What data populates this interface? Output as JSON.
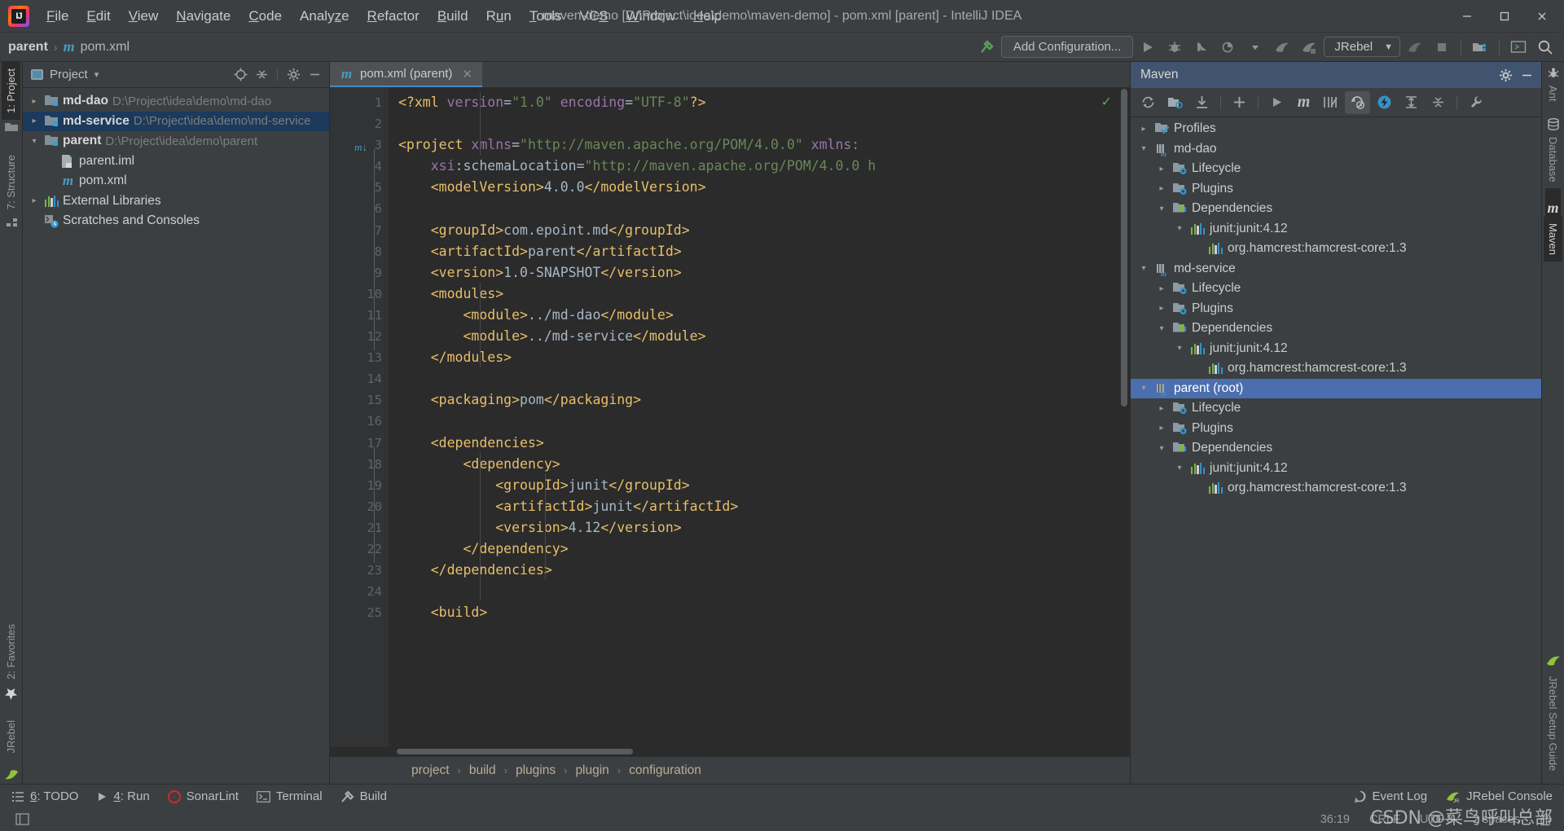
{
  "window": {
    "title": "maven-demo [D:\\Project\\idea\\demo\\maven-demo] - pom.xml [parent] - IntelliJ IDEA",
    "minimize": "–",
    "maximize": "☐",
    "close": "✕",
    "logo_text": "IJ"
  },
  "menubar": [
    {
      "label": "File",
      "mnemonic": "F"
    },
    {
      "label": "Edit",
      "mnemonic": "E"
    },
    {
      "label": "View",
      "mnemonic": "V"
    },
    {
      "label": "Navigate",
      "mnemonic": "N"
    },
    {
      "label": "Code",
      "mnemonic": "C"
    },
    {
      "label": "Analyze",
      "mnemonic": "z"
    },
    {
      "label": "Refactor",
      "mnemonic": "R"
    },
    {
      "label": "Build",
      "mnemonic": "B"
    },
    {
      "label": "Run",
      "mnemonic": "u"
    },
    {
      "label": "Tools",
      "mnemonic": "T"
    },
    {
      "label": "VCS",
      "mnemonic": "S"
    },
    {
      "label": "Window",
      "mnemonic": "W"
    },
    {
      "label": "Help",
      "mnemonic": "H"
    }
  ],
  "toolbar": {
    "breadcrumb_project": "parent",
    "breadcrumb_sep": "›",
    "breadcrumb_file_icon": "m",
    "breadcrumb_file": "pom.xml",
    "add_configuration": "Add Configuration...",
    "jrebel_label": "JRebel",
    "jrebel_caret": "▼",
    "icons": {
      "build": "build-hammer-icon",
      "run": "run-icon",
      "debug": "debug-icon",
      "run_coverage": "run-with-coverage-icon",
      "profiler": "profiler-icon",
      "jrebel_run": "jrebel-run-icon",
      "jrebel_debug": "jrebel-debug-icon",
      "jrebel_stop": "jrebel-stop-icon",
      "stop": "stop-icon",
      "project_structure": "project-structure-icon",
      "terminal": "terminal-icon",
      "search": "search-everywhere-icon"
    }
  },
  "left_strip": [
    {
      "label": "1: Project",
      "mnemonic": "1",
      "active": true,
      "icon": "project-icon"
    },
    {
      "label": "7: Structure",
      "mnemonic": "7",
      "active": false,
      "icon": "structure-icon"
    },
    {
      "label": "2: Favorites",
      "mnemonic": "2",
      "active": false,
      "icon": "star-icon"
    },
    {
      "label": "JRebel",
      "mnemonic": "",
      "active": false,
      "icon": "jrebel-icon"
    }
  ],
  "right_strip": [
    {
      "label": "Ant",
      "active": false,
      "icon": "ant-icon"
    },
    {
      "label": "Database",
      "active": false,
      "icon": "database-icon"
    },
    {
      "label": "Maven",
      "active": true,
      "icon": "maven-icon"
    },
    {
      "label": "JRebel Setup Guide",
      "active": false,
      "icon": "jrebel-icon"
    }
  ],
  "project_panel": {
    "title": "Project",
    "caret": "▾",
    "actions": [
      "locate-icon",
      "collapse-all-icon",
      "settings-gear-icon",
      "hide-icon"
    ],
    "tree": [
      {
        "indent": 0,
        "arrow": "▸",
        "icon": "module-folder-icon",
        "label": "md-dao",
        "bold": true,
        "path": "D:\\Project\\idea\\demo\\md-dao",
        "selected": false
      },
      {
        "indent": 0,
        "arrow": "▸",
        "icon": "module-folder-icon",
        "label": "md-service",
        "bold": true,
        "path": "D:\\Project\\idea\\demo\\md-service",
        "selected": true
      },
      {
        "indent": 0,
        "arrow": "▾",
        "icon": "module-folder-icon",
        "label": "parent",
        "bold": true,
        "path": "D:\\Project\\idea\\demo\\parent",
        "selected": false
      },
      {
        "indent": 1,
        "arrow": "",
        "icon": "iml-file-icon",
        "label": "parent.iml",
        "bold": false,
        "path": "",
        "selected": false
      },
      {
        "indent": 1,
        "arrow": "",
        "icon": "maven-file-icon",
        "label": "pom.xml",
        "bold": false,
        "path": "",
        "selected": false
      },
      {
        "indent": 0,
        "arrow": "▸",
        "icon": "library-icon",
        "label": "External Libraries",
        "bold": false,
        "path": "",
        "selected": false
      },
      {
        "indent": 0,
        "arrow": "",
        "icon": "scratches-icon",
        "label": "Scratches and Consoles",
        "bold": false,
        "path": "",
        "selected": false
      }
    ]
  },
  "editor": {
    "tab": {
      "icon": "maven-file-icon",
      "label": "pom.xml (parent)",
      "close": "✕"
    },
    "inspection_status": "✓",
    "gutter_marker_line": 3,
    "gutter_marker": "m",
    "lines": [
      {
        "n": 1,
        "fold": "",
        "segments": [
          {
            "t": "<?xml ",
            "c": "tag"
          },
          {
            "t": "version",
            "c": "attr"
          },
          {
            "t": "=",
            "c": "txt"
          },
          {
            "t": "\"1.0\"",
            "c": "str"
          },
          {
            "t": " ",
            "c": "txt"
          },
          {
            "t": "encoding",
            "c": "attr"
          },
          {
            "t": "=",
            "c": "txt"
          },
          {
            "t": "\"UTF-8\"",
            "c": "str"
          },
          {
            "t": "?>",
            "c": "tag"
          }
        ]
      },
      {
        "n": 2,
        "fold": "",
        "segments": []
      },
      {
        "n": 3,
        "fold": "-",
        "segments": [
          {
            "t": "<project ",
            "c": "tag"
          },
          {
            "t": "xmlns",
            "c": "attr"
          },
          {
            "t": "=",
            "c": "txt"
          },
          {
            "t": "\"http://maven.apache.org/POM/4.0.0\"",
            "c": "str"
          },
          {
            "t": " ",
            "c": "txt"
          },
          {
            "t": "xmlns:",
            "c": "attr"
          }
        ]
      },
      {
        "n": 4,
        "fold": "",
        "segments": [
          {
            "t": "    ",
            "c": "txt"
          },
          {
            "t": "xsi",
            "c": "attr"
          },
          {
            "t": ":schemaLocation",
            "c": "txt"
          },
          {
            "t": "=",
            "c": "txt"
          },
          {
            "t": "\"http://maven.apache.org/POM/4.0.0 h",
            "c": "str"
          }
        ]
      },
      {
        "n": 5,
        "fold": "",
        "segments": [
          {
            "t": "    ",
            "c": "txt"
          },
          {
            "t": "<modelVersion>",
            "c": "tag"
          },
          {
            "t": "4.0.0",
            "c": "txt"
          },
          {
            "t": "</modelVersion>",
            "c": "tag"
          }
        ]
      },
      {
        "n": 6,
        "fold": "",
        "segments": []
      },
      {
        "n": 7,
        "fold": "",
        "segments": [
          {
            "t": "    ",
            "c": "txt"
          },
          {
            "t": "<groupId>",
            "c": "tag"
          },
          {
            "t": "com.epoint.md",
            "c": "txt"
          },
          {
            "t": "</groupId>",
            "c": "tag"
          }
        ]
      },
      {
        "n": 8,
        "fold": "",
        "segments": [
          {
            "t": "    ",
            "c": "txt"
          },
          {
            "t": "<artifactId>",
            "c": "tag"
          },
          {
            "t": "parent",
            "c": "txt"
          },
          {
            "t": "</artifactId>",
            "c": "tag"
          }
        ]
      },
      {
        "n": 9,
        "fold": "",
        "segments": [
          {
            "t": "    ",
            "c": "txt"
          },
          {
            "t": "<version>",
            "c": "tag"
          },
          {
            "t": "1.0-SNAPSHOT",
            "c": "txt"
          },
          {
            "t": "</version>",
            "c": "tag"
          }
        ]
      },
      {
        "n": 10,
        "fold": "-",
        "segments": [
          {
            "t": "    ",
            "c": "txt"
          },
          {
            "t": "<modules>",
            "c": "tag"
          }
        ]
      },
      {
        "n": 11,
        "fold": "",
        "segments": [
          {
            "t": "        ",
            "c": "txt"
          },
          {
            "t": "<module>",
            "c": "tag"
          },
          {
            "t": "../md-dao",
            "c": "txt"
          },
          {
            "t": "</module>",
            "c": "tag"
          }
        ]
      },
      {
        "n": 12,
        "fold": "",
        "segments": [
          {
            "t": "        ",
            "c": "txt"
          },
          {
            "t": "<module>",
            "c": "tag"
          },
          {
            "t": "../md-service",
            "c": "txt"
          },
          {
            "t": "</module>",
            "c": "tag"
          }
        ]
      },
      {
        "n": 13,
        "fold": "u",
        "segments": [
          {
            "t": "    ",
            "c": "txt"
          },
          {
            "t": "</modules>",
            "c": "tag"
          }
        ]
      },
      {
        "n": 14,
        "fold": "",
        "segments": []
      },
      {
        "n": 15,
        "fold": "",
        "segments": [
          {
            "t": "    ",
            "c": "txt"
          },
          {
            "t": "<packaging>",
            "c": "tag"
          },
          {
            "t": "pom",
            "c": "txt"
          },
          {
            "t": "</packaging>",
            "c": "tag"
          }
        ]
      },
      {
        "n": 16,
        "fold": "",
        "segments": []
      },
      {
        "n": 17,
        "fold": "-",
        "segments": [
          {
            "t": "    ",
            "c": "txt"
          },
          {
            "t": "<dependencies>",
            "c": "tag"
          }
        ]
      },
      {
        "n": 18,
        "fold": "-",
        "segments": [
          {
            "t": "        ",
            "c": "txt"
          },
          {
            "t": "<dependency>",
            "c": "tag"
          }
        ]
      },
      {
        "n": 19,
        "fold": "",
        "segments": [
          {
            "t": "            ",
            "c": "txt"
          },
          {
            "t": "<groupId>",
            "c": "tag"
          },
          {
            "t": "junit",
            "c": "txt"
          },
          {
            "t": "</groupId>",
            "c": "tag"
          }
        ]
      },
      {
        "n": 20,
        "fold": "",
        "segments": [
          {
            "t": "            ",
            "c": "txt"
          },
          {
            "t": "<artifactId>",
            "c": "tag"
          },
          {
            "t": "junit",
            "c": "txt"
          },
          {
            "t": "</artifactId>",
            "c": "tag"
          }
        ]
      },
      {
        "n": 21,
        "fold": "",
        "segments": [
          {
            "t": "            ",
            "c": "txt"
          },
          {
            "t": "<version>",
            "c": "tag"
          },
          {
            "t": "4.12",
            "c": "txt"
          },
          {
            "t": "</version>",
            "c": "tag"
          }
        ]
      },
      {
        "n": 22,
        "fold": "u",
        "segments": [
          {
            "t": "        ",
            "c": "txt"
          },
          {
            "t": "</dependency>",
            "c": "tag"
          }
        ]
      },
      {
        "n": 23,
        "fold": "u",
        "segments": [
          {
            "t": "    ",
            "c": "txt"
          },
          {
            "t": "</dependencies>",
            "c": "tag"
          }
        ]
      },
      {
        "n": 24,
        "fold": "",
        "segments": []
      },
      {
        "n": 25,
        "fold": "-",
        "segments": [
          {
            "t": "    ",
            "c": "txt"
          },
          {
            "t": "<build>",
            "c": "tag"
          }
        ]
      }
    ],
    "breadcrumbs": [
      "project",
      "build",
      "plugins",
      "plugin",
      "configuration"
    ],
    "breadcrumb_sep": "›"
  },
  "maven_panel": {
    "title": "Maven",
    "actions": [
      "settings-gear-icon",
      "hide-icon"
    ],
    "toolbar_icons": [
      "reimport-icon",
      "generate-sources-icon",
      "download-sources-icon",
      "add-maven-project-icon",
      "run-icon",
      "maven-goal-icon",
      "toggle-skip-tests-icon",
      "toggle-offline-icon",
      "execute-goal-icon",
      "expand-all-icon",
      "collapse-all-icon",
      "maven-settings-icon"
    ],
    "tree": [
      {
        "indent": 0,
        "arrow": "▸",
        "icon": "profiles-icon",
        "label": "Profiles",
        "selected": false
      },
      {
        "indent": 0,
        "arrow": "▾",
        "icon": "maven-module-icon",
        "label": "md-dao",
        "selected": false
      },
      {
        "indent": 1,
        "arrow": "▸",
        "icon": "lifecycle-folder-icon",
        "label": "Lifecycle",
        "selected": false
      },
      {
        "indent": 1,
        "arrow": "▸",
        "icon": "plugins-folder-icon",
        "label": "Plugins",
        "selected": false
      },
      {
        "indent": 1,
        "arrow": "▾",
        "icon": "dependencies-icon",
        "label": "Dependencies",
        "selected": false
      },
      {
        "indent": 2,
        "arrow": "▾",
        "icon": "library-icon",
        "label": "junit:junit:4.12",
        "selected": false
      },
      {
        "indent": 3,
        "arrow": "",
        "icon": "library-icon",
        "label": "org.hamcrest:hamcrest-core:1.3",
        "selected": false
      },
      {
        "indent": 0,
        "arrow": "▾",
        "icon": "maven-module-icon",
        "label": "md-service",
        "selected": false
      },
      {
        "indent": 1,
        "arrow": "▸",
        "icon": "lifecycle-folder-icon",
        "label": "Lifecycle",
        "selected": false
      },
      {
        "indent": 1,
        "arrow": "▸",
        "icon": "plugins-folder-icon",
        "label": "Plugins",
        "selected": false
      },
      {
        "indent": 1,
        "arrow": "▾",
        "icon": "dependencies-icon",
        "label": "Dependencies",
        "selected": false
      },
      {
        "indent": 2,
        "arrow": "▾",
        "icon": "library-icon",
        "label": "junit:junit:4.12",
        "selected": false
      },
      {
        "indent": 3,
        "arrow": "",
        "icon": "library-icon",
        "label": "org.hamcrest:hamcrest-core:1.3",
        "selected": false
      },
      {
        "indent": 0,
        "arrow": "▾",
        "icon": "maven-module-icon",
        "label": "parent (root)",
        "selected": true
      },
      {
        "indent": 1,
        "arrow": "▸",
        "icon": "lifecycle-folder-icon",
        "label": "Lifecycle",
        "selected": false
      },
      {
        "indent": 1,
        "arrow": "▸",
        "icon": "plugins-folder-icon",
        "label": "Plugins",
        "selected": false
      },
      {
        "indent": 1,
        "arrow": "▾",
        "icon": "dependencies-icon",
        "label": "Dependencies",
        "selected": false
      },
      {
        "indent": 2,
        "arrow": "▾",
        "icon": "library-icon",
        "label": "junit:junit:4.12",
        "selected": false
      },
      {
        "indent": 3,
        "arrow": "",
        "icon": "library-icon",
        "label": "org.hamcrest:hamcrest-core:1.3",
        "selected": false
      }
    ]
  },
  "toolwindow_bar": {
    "left": [
      {
        "label": "6: TODO",
        "mnemonic": "6",
        "icon": "todo-list-icon"
      },
      {
        "label": "4: Run",
        "mnemonic": "4",
        "icon": "run-icon"
      },
      {
        "label": "SonarLint",
        "mnemonic": "",
        "icon": "sonarlint-icon"
      },
      {
        "label": "Terminal",
        "mnemonic": "",
        "icon": "terminal-icon"
      },
      {
        "label": "Build",
        "mnemonic": "",
        "icon": "build-hammer-icon"
      }
    ],
    "right": [
      {
        "label": "Event Log",
        "icon": "event-log-icon"
      },
      {
        "label": "JRebel Console",
        "icon": "jrebel-icon"
      }
    ]
  },
  "statusbar": {
    "left_icon": "show-hide-toolwindows-icon",
    "caret_position": "36:19",
    "line_separator": "CRLF",
    "encoding": "UTF-8",
    "indent": "2 spaces",
    "lock_icon": "read-only-lock-icon",
    "watermark": "CSDN @菜鸟呼叫总部"
  },
  "colors": {
    "accent_blue": "#4b6eaf",
    "selection_tree": "#1b3a5c",
    "tag": "#e8bf6a",
    "string": "#6a8759",
    "attribute": "#9876aa",
    "text": "#a9b7c6",
    "panel_bg": "#3c3f41",
    "editor_bg": "#2b2b2b"
  }
}
